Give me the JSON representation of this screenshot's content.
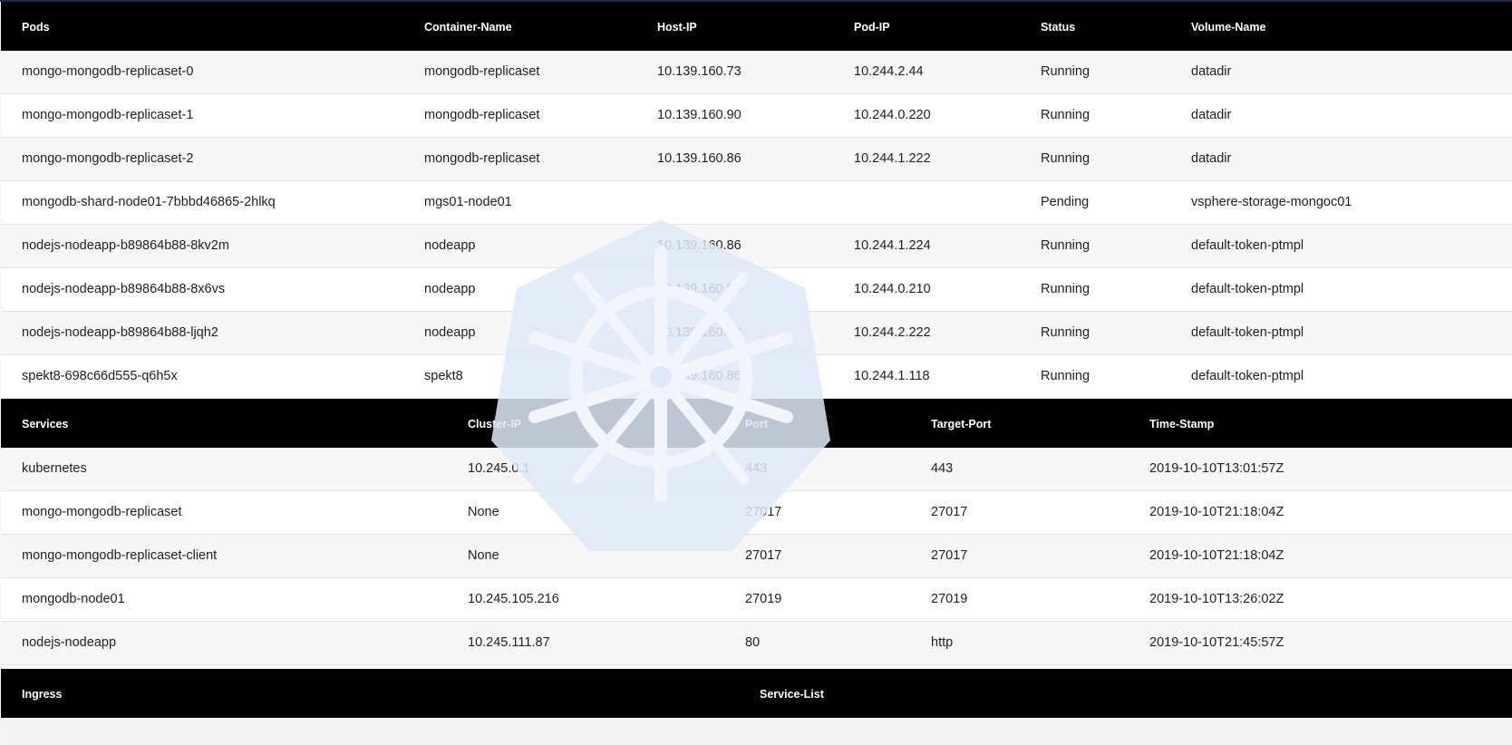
{
  "pods": {
    "headers": [
      "Pods",
      "Container-Name",
      "Host-IP",
      "Pod-IP",
      "Status",
      "Volume-Name"
    ],
    "rows": [
      [
        "mongo-mongodb-replicaset-0",
        "mongodb-replicaset",
        "10.139.160.73",
        "10.244.2.44",
        "Running",
        "datadir"
      ],
      [
        "mongo-mongodb-replicaset-1",
        "mongodb-replicaset",
        "10.139.160.90",
        "10.244.0.220",
        "Running",
        "datadir"
      ],
      [
        "mongo-mongodb-replicaset-2",
        "mongodb-replicaset",
        "10.139.160.86",
        "10.244.1.222",
        "Running",
        "datadir"
      ],
      [
        "mongodb-shard-node01-7bbbd46865-2hlkq",
        "mgs01-node01",
        "",
        "",
        "Pending",
        "vsphere-storage-mongoc01"
      ],
      [
        "nodejs-nodeapp-b89864b88-8kv2m",
        "nodeapp",
        "10.139.160.86",
        "10.244.1.224",
        "Running",
        "default-token-ptmpl"
      ],
      [
        "nodejs-nodeapp-b89864b88-8x6vs",
        "nodeapp",
        "10.139.160.90",
        "10.244.0.210",
        "Running",
        "default-token-ptmpl"
      ],
      [
        "nodejs-nodeapp-b89864b88-ljqh2",
        "nodeapp",
        "10.139.160.73",
        "10.244.2.222",
        "Running",
        "default-token-ptmpl"
      ],
      [
        "spekt8-698c66d555-q6h5x",
        "spekt8",
        "10.139.160.86",
        "10.244.1.118",
        "Running",
        "default-token-ptmpl"
      ]
    ]
  },
  "services": {
    "headers": [
      "Services",
      "Cluster-IP",
      "Port",
      "Target-Port",
      "Time-Stamp"
    ],
    "rows": [
      [
        "kubernetes",
        "10.245.0.1",
        "443",
        "443",
        "2019-10-10T13:01:57Z"
      ],
      [
        "mongo-mongodb-replicaset",
        "None",
        "27017",
        "27017",
        "2019-10-10T21:18:04Z"
      ],
      [
        "mongo-mongodb-replicaset-client",
        "None",
        "27017",
        "27017",
        "2019-10-10T21:18:04Z"
      ],
      [
        "mongodb-node01",
        "10.245.105.216",
        "27019",
        "27019",
        "2019-10-10T13:26:02Z"
      ],
      [
        "nodejs-nodeapp",
        "10.245.111.87",
        "80",
        "http",
        "2019-10-10T21:45:57Z"
      ]
    ]
  },
  "ingress": {
    "headers": [
      "Ingress",
      "Service-List"
    ]
  },
  "watermark": {
    "icon": "kubernetes-helm-icon",
    "color": "#e3eaf8"
  }
}
